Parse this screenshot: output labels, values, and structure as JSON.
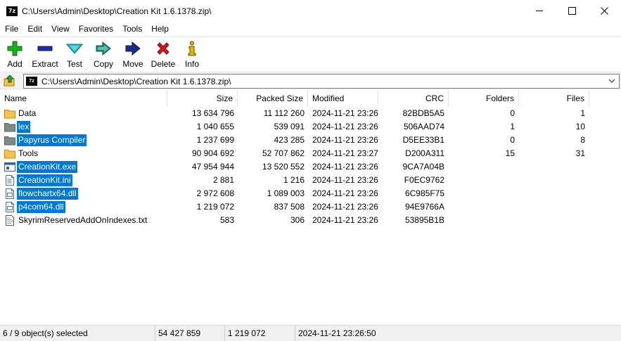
{
  "window": {
    "title": "C:\\Users\\Admin\\Desktop\\Creation Kit 1.6.1378.zip\\",
    "app_icon_text": "7z"
  },
  "menu": [
    "File",
    "Edit",
    "View",
    "Favorites",
    "Tools",
    "Help"
  ],
  "toolbar": [
    {
      "label": "Add",
      "icon": "plus-icon",
      "color": "#17b21a"
    },
    {
      "label": "Extract",
      "icon": "minus-icon",
      "color": "#1c2ea8"
    },
    {
      "label": "Test",
      "icon": "check-icon",
      "color": "#18b8c8"
    },
    {
      "label": "Copy",
      "icon": "copy-arrow-icon",
      "color": "#1f8f7a"
    },
    {
      "label": "Move",
      "icon": "move-arrow-icon",
      "color": "#1a2d8f"
    },
    {
      "label": "Delete",
      "icon": "delete-x-icon",
      "color": "#d9141a"
    },
    {
      "label": "Info",
      "icon": "info-icon",
      "color": "#e2b400"
    }
  ],
  "address": {
    "path": "C:\\Users\\Admin\\Desktop\\Creation Kit 1.6.1378.zip\\"
  },
  "columns": {
    "name": "Name",
    "size": "Size",
    "packed": "Packed Size",
    "modified": "Modified",
    "crc": "CRC",
    "folders": "Folders",
    "files": "Files"
  },
  "rows": [
    {
      "name": "Data",
      "type": "folder",
      "size": "13 634 796",
      "packed": "11 112 260",
      "modified": "2024-11-21 23:26",
      "crc": "82BDB5A5",
      "folders": "0",
      "files": "1",
      "selected": false
    },
    {
      "name": "lex",
      "type": "folder",
      "size": "1 040 655",
      "packed": "539 091",
      "modified": "2024-11-21 23:26",
      "crc": "506AAD74",
      "folders": "1",
      "files": "10",
      "selected": true
    },
    {
      "name": "Papyrus Compiler",
      "type": "folder",
      "size": "1 237 699",
      "packed": "423 285",
      "modified": "2024-11-21 23:26",
      "crc": "D5EE33B1",
      "folders": "0",
      "files": "8",
      "selected": true
    },
    {
      "name": "Tools",
      "type": "folder",
      "size": "90 904 692",
      "packed": "52 707 862",
      "modified": "2024-11-21 23:27",
      "crc": "D200A311",
      "folders": "15",
      "files": "31",
      "selected": false
    },
    {
      "name": "CreationKit.exe",
      "type": "exe",
      "size": "47 954 944",
      "packed": "13 520 552",
      "modified": "2024-11-21 23:26",
      "crc": "9CA7A04B",
      "folders": "",
      "files": "",
      "selected": true
    },
    {
      "name": "CreationKit.ini",
      "type": "ini",
      "size": "2 881",
      "packed": "1 216",
      "modified": "2024-11-21 23:26",
      "crc": "F0EC9762",
      "folders": "",
      "files": "",
      "selected": true
    },
    {
      "name": "flowchartx64.dll",
      "type": "dll",
      "size": "2 972 608",
      "packed": "1 089 003",
      "modified": "2024-11-21 23:26",
      "crc": "6C985F75",
      "folders": "",
      "files": "",
      "selected": true
    },
    {
      "name": "p4com64.dll",
      "type": "dll",
      "size": "1 219 072",
      "packed": "837 508",
      "modified": "2024-11-21 23:26",
      "crc": "94E9766A",
      "folders": "",
      "files": "",
      "selected": true
    },
    {
      "name": "SkyrimReservedAddOnIndexes.txt",
      "type": "txt",
      "size": "583",
      "packed": "306",
      "modified": "2024-11-21 23:26",
      "crc": "53895B1B",
      "folders": "",
      "files": "",
      "selected": false
    }
  ],
  "status": {
    "selection": "6 / 9 object(s) selected",
    "total_size": "54 427 859",
    "packed_size": "1 219 072",
    "modified": "2024-11-21 23:26:50"
  },
  "colors": {
    "selection": "#0078d7",
    "folder": "#f5c24a",
    "folder_selected": "#7d8a86"
  }
}
